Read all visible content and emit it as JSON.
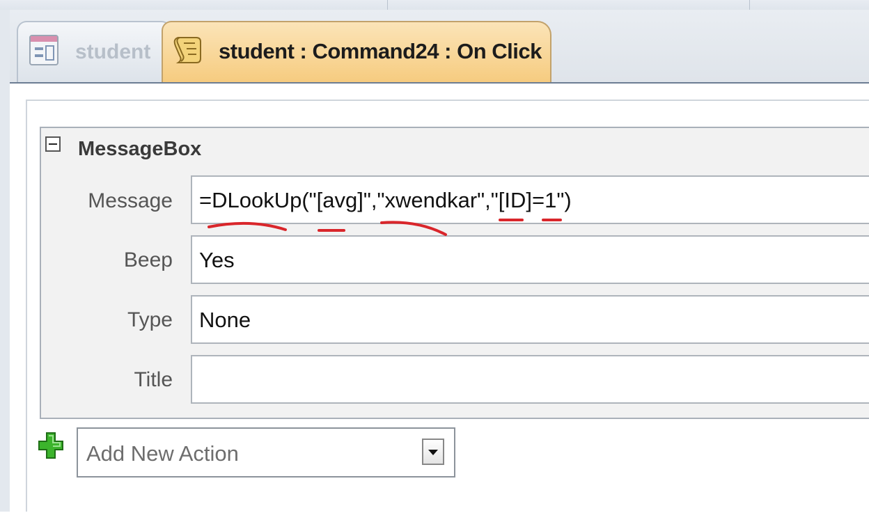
{
  "tabs": [
    {
      "label": "student",
      "icon": "form-icon",
      "active": false
    },
    {
      "label": "student : Command24 : On Click",
      "icon": "macro-scroll-icon",
      "active": true
    }
  ],
  "action": {
    "name": "MessageBox",
    "collapse_icon": "minus-collapse-icon",
    "arguments": [
      {
        "label": "Message",
        "value": "=DLookUp(\"[avg]\",\"xwendkar\",\"[ID]=1\")"
      },
      {
        "label": "Beep",
        "value": "Yes"
      },
      {
        "label": "Type",
        "value": "None"
      },
      {
        "label": "Title",
        "value": ""
      }
    ]
  },
  "add_action": {
    "placeholder": "Add New Action",
    "icon": "green-plus-icon",
    "dropdown_icon": "chevron-down-icon"
  },
  "colors": {
    "active_tab": "#f6cb7e",
    "annotation": "#d9262b",
    "plus": "#3cb42c"
  }
}
